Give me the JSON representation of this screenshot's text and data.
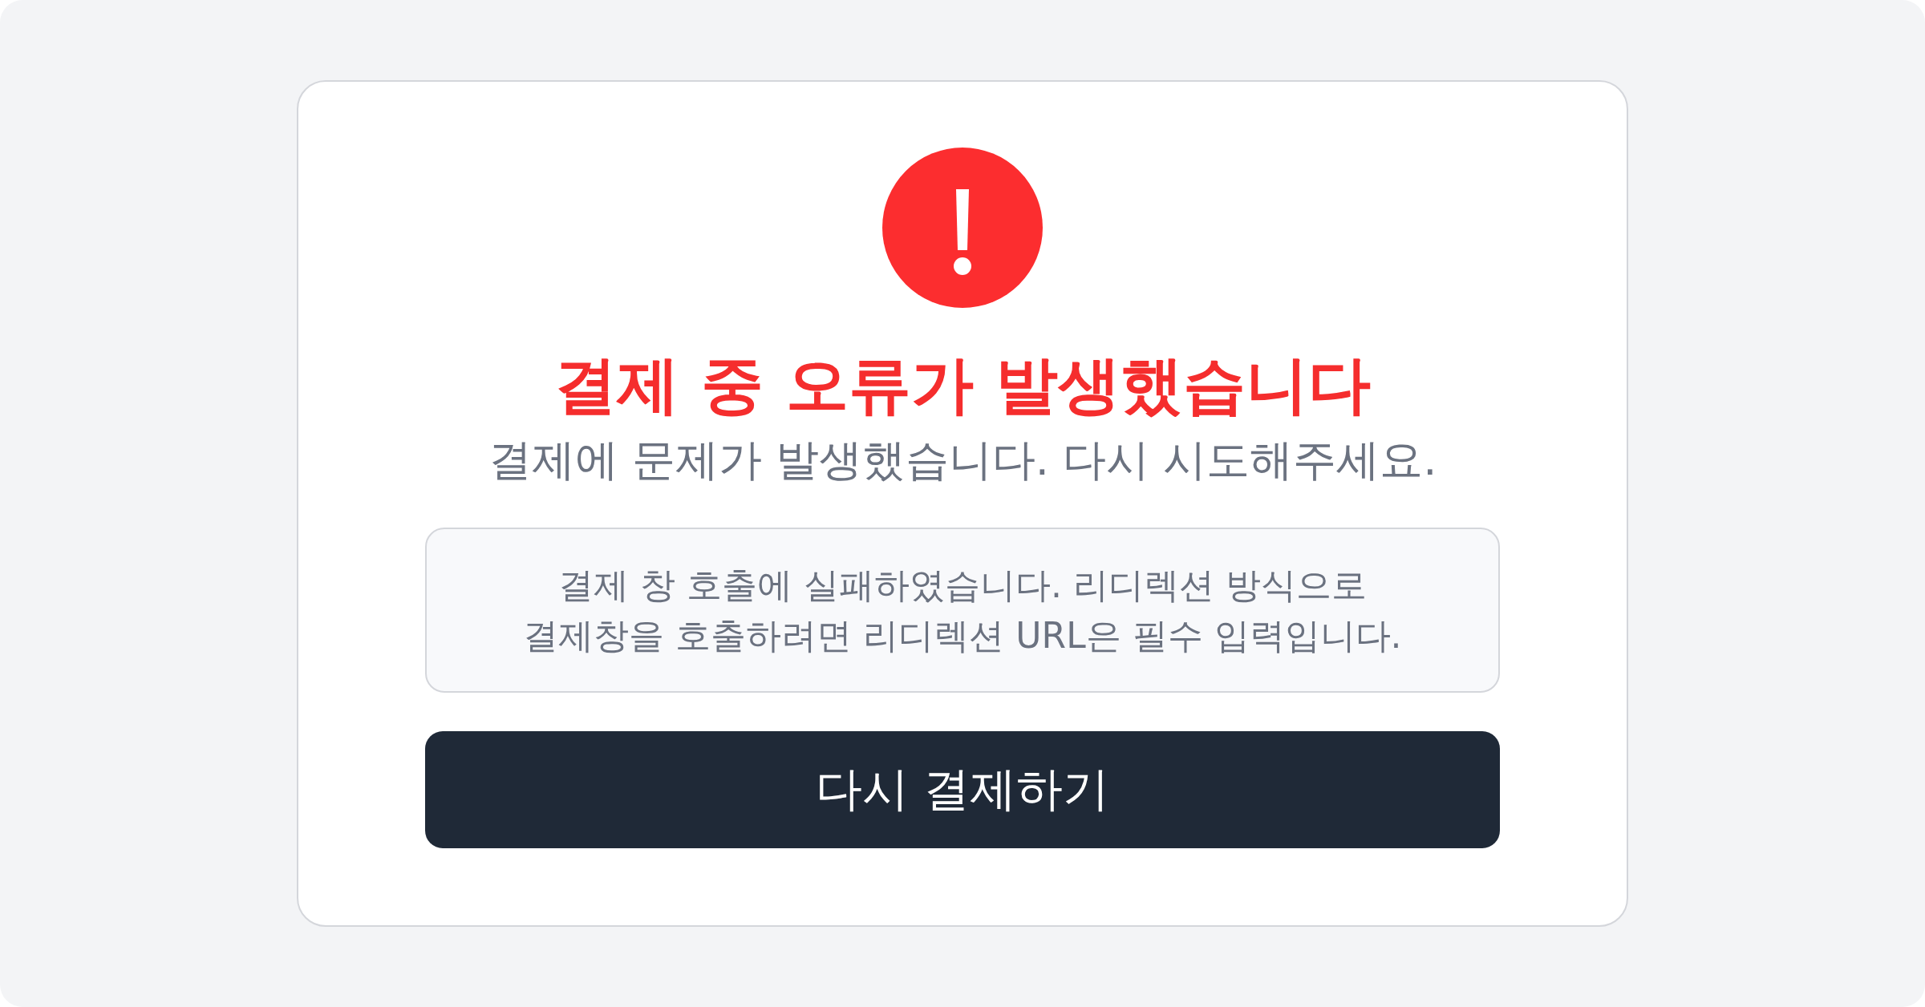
{
  "error": {
    "title": "결제 중 오류가 발생했습니다",
    "subtitle": "결제에 문제가 발생했습니다. 다시 시도해주세요.",
    "detail": "결제 창 호출에 실패하였습니다. 리디렉션 방식으로\n결제창을 호출하려면 리디렉션 URL은 필수 입력입니다.",
    "button": "다시 결제하기"
  }
}
